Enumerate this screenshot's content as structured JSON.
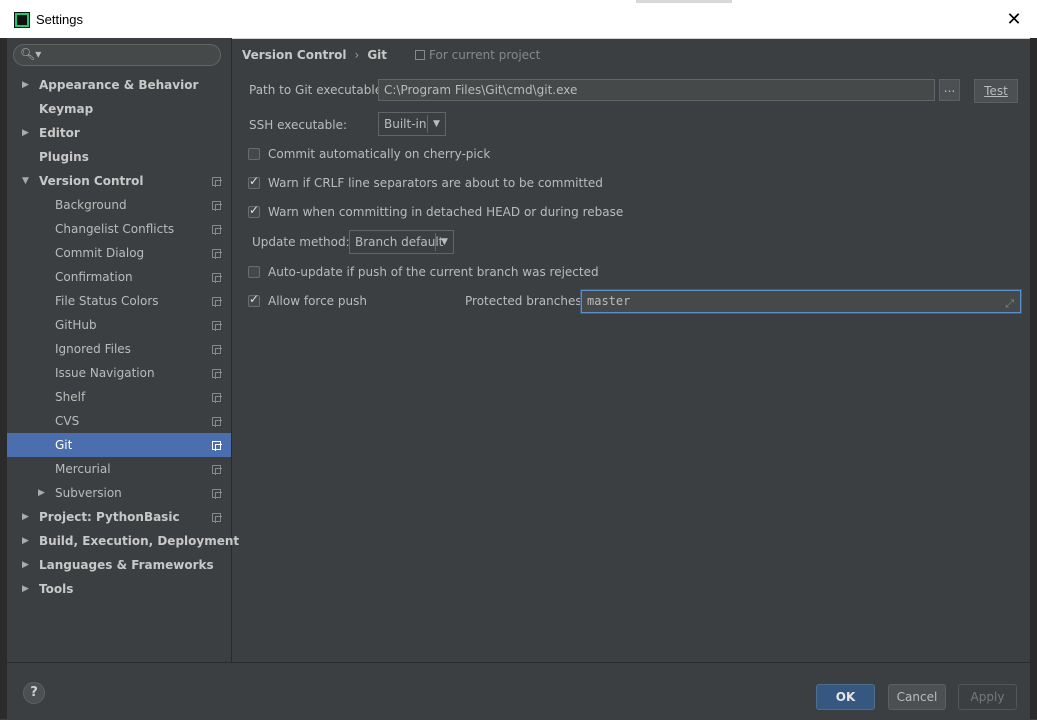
{
  "window": {
    "title": "Settings",
    "close_glyph": "✕"
  },
  "search": {
    "icon": "search-icon",
    "glyph": "🔍︎▾",
    "placeholder": ""
  },
  "sidebar": {
    "items": [
      {
        "label": "Appearance & Behavior",
        "level": 0,
        "expandable": true,
        "expanded": false,
        "bold": true
      },
      {
        "label": "Keymap",
        "level": 0,
        "expandable": false,
        "bold": true
      },
      {
        "label": "Editor",
        "level": 0,
        "expandable": true,
        "expanded": false,
        "bold": true
      },
      {
        "label": "Plugins",
        "level": 0,
        "expandable": false,
        "bold": true
      },
      {
        "label": "Version Control",
        "level": 0,
        "expandable": true,
        "expanded": true,
        "bold": true,
        "project": true
      },
      {
        "label": "Background",
        "level": 1,
        "project": true
      },
      {
        "label": "Changelist Conflicts",
        "level": 1,
        "project": true
      },
      {
        "label": "Commit Dialog",
        "level": 1,
        "project": true
      },
      {
        "label": "Confirmation",
        "level": 1,
        "project": true
      },
      {
        "label": "File Status Colors",
        "level": 1,
        "project": true
      },
      {
        "label": "GitHub",
        "level": 1,
        "project": true
      },
      {
        "label": "Ignored Files",
        "level": 1,
        "project": true
      },
      {
        "label": "Issue Navigation",
        "level": 1,
        "project": true
      },
      {
        "label": "Shelf",
        "level": 1,
        "project": true
      },
      {
        "label": "CVS",
        "level": 1,
        "project": true
      },
      {
        "label": "Git",
        "level": 1,
        "project": true,
        "selected": true
      },
      {
        "label": "Mercurial",
        "level": 1,
        "project": true
      },
      {
        "label": "Subversion",
        "level": 1,
        "expandable": true,
        "expanded": false,
        "project": true
      },
      {
        "label": "Project: PythonBasic",
        "level": 0,
        "expandable": true,
        "expanded": false,
        "bold": true,
        "project": true
      },
      {
        "label": "Build, Execution, Deployment",
        "level": 0,
        "expandable": true,
        "expanded": false,
        "bold": true
      },
      {
        "label": "Languages & Frameworks",
        "level": 0,
        "expandable": true,
        "expanded": false,
        "bold": true
      },
      {
        "label": "Tools",
        "level": 0,
        "expandable": true,
        "expanded": false,
        "bold": true
      }
    ]
  },
  "breadcrumb": {
    "parent": "Version Control",
    "separator": "›",
    "current": "Git",
    "scope": "For current project"
  },
  "git": {
    "path_label": "Path to Git executable:",
    "path_value": "C:\\Program Files\\Git\\cmd\\git.exe",
    "browse_label": "...",
    "test_label": "Test",
    "ssh_label": "SSH executable:",
    "ssh_value": "Built-in",
    "cherry_pick_label": "Commit automatically on cherry-pick",
    "cherry_pick_checked": false,
    "crlf_label": "Warn if CRLF line separators are about to be committed",
    "crlf_checked": true,
    "detached_label": "Warn when committing in detached HEAD or during rebase",
    "detached_checked": true,
    "update_method_label": "Update method:",
    "update_method_value": "Branch default",
    "auto_update_label": "Auto-update if push of the current branch was rejected",
    "auto_update_checked": false,
    "force_push_label": "Allow force push",
    "force_push_checked": true,
    "protected_label": "Protected branches:",
    "protected_value": "master"
  },
  "footer": {
    "help_label": "?",
    "ok_label": "OK",
    "cancel_label": "Cancel",
    "apply_label": "Apply"
  },
  "colors": {
    "background": "#3c3f41",
    "selection": "#4b6eaf",
    "default_button": "#365880",
    "focus": "#5b8fc6"
  }
}
